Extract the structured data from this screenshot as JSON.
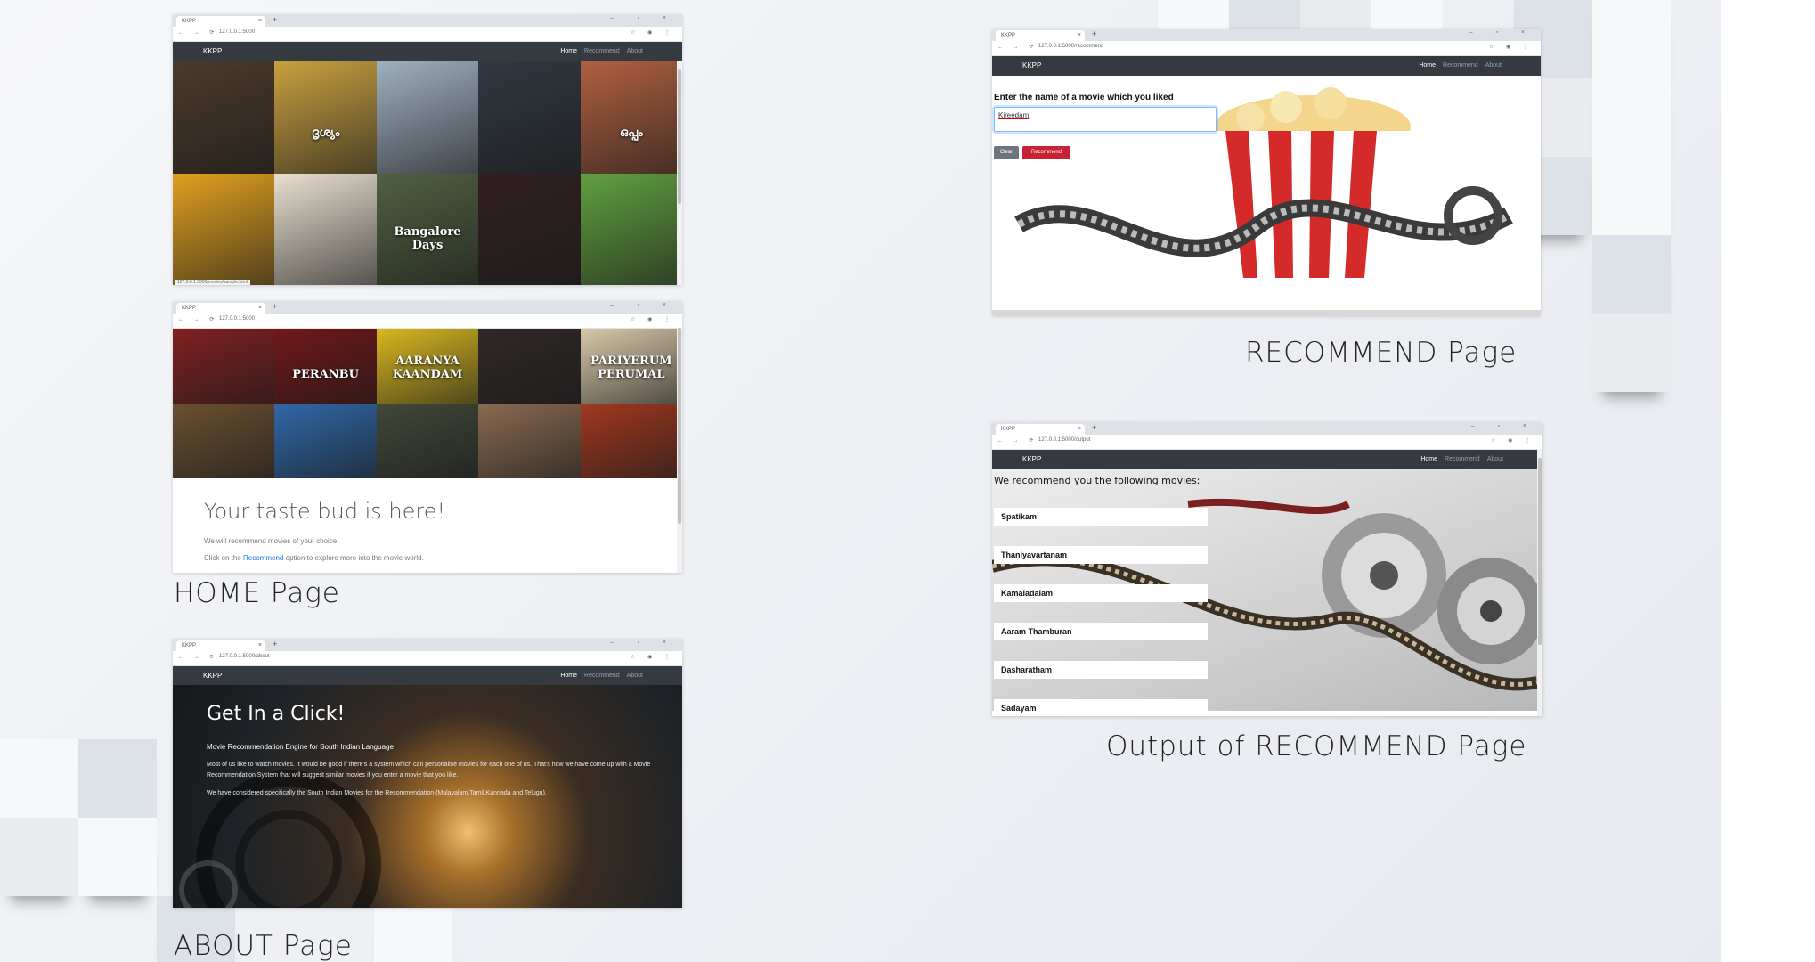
{
  "captions": {
    "home": "HOME Page",
    "about": "ABOUT Page",
    "recommend": "RECOMMEND Page",
    "output": "Output of RECOMMEND Page"
  },
  "browser": {
    "tab_title": "KKPP",
    "new_tab": "+",
    "window_controls": "– ▫ ×",
    "nav_glyphs": "← → ⟳",
    "tool_glyphs": "☆ ◉ ⋮",
    "urls": {
      "home": "127.0.0.1:5000",
      "about": "127.0.0.1:5000/about",
      "recommend": "127.0.0.1:5000/recommend",
      "output": "127.0.0.1:5000/output"
    }
  },
  "site": {
    "brand": "KKPP",
    "nav": [
      "Home",
      "Recommend",
      "About"
    ]
  },
  "home": {
    "status_url": "127.0.0.1:5000/movies/sample.html",
    "tagline": "Your taste bud is here!",
    "desc1": "We will recommend movies of your choice.",
    "desc2_pre": "Click on the ",
    "desc2_link": "Recommend",
    "desc2_post": " option to explore more into the movie world.",
    "poster_texts": [
      "",
      "ദൃശ്യം",
      "",
      "",
      "ഒപ്പം",
      "",
      "",
      "Bangalore Days",
      "",
      "",
      "",
      "PERANBU",
      "AARANYA KAANDAM",
      "",
      "PARIYERUM PERUMAL",
      "",
      "",
      "",
      "",
      ""
    ],
    "poster_colors": [
      "#4a3a2a",
      "#c8a040",
      "#a0b0c0",
      "#303840",
      "#b06040",
      "#e0a020",
      "#e8e0d0",
      "#506040",
      "#302020",
      "#60a040",
      "#802020",
      "#701818",
      "#d8b820",
      "#302828",
      "#d8c8a8",
      "#6a5030",
      "#3068a8",
      "#404838",
      "#8a6a50",
      "#a03820"
    ]
  },
  "about": {
    "heading": "Get In a Click!",
    "subheading": "Movie Recommendation Engine for South Indian Language",
    "para1": "Most of us like to watch movies. It would be good if there's a system which can personalise movies for each one of us. That's how we have come up with a Movie Recommendation System that will suggest similar movies if you enter a movie that you like.",
    "para2": "We have considered specifically the South Indian Movies for the Recommendation (Malayalam,Tamil,Kannada and Telugu)."
  },
  "recommend": {
    "prompt": "Enter the name of a movie which you liked",
    "input_value": "Kireedam",
    "clear_label": "Clear",
    "recommend_label": "Recommend"
  },
  "output": {
    "heading": "We recommend you the following movies:",
    "movies": [
      "Spatikam",
      "Thaniyavartanam",
      "Kamaladalam",
      "Aaram Thamburan",
      "Dasharatham",
      "Sadayam"
    ]
  },
  "colors": {
    "navbar": "#343a40",
    "recommend_button": "#c82333",
    "clear_button": "#6c757d",
    "link": "#1a73e8"
  }
}
